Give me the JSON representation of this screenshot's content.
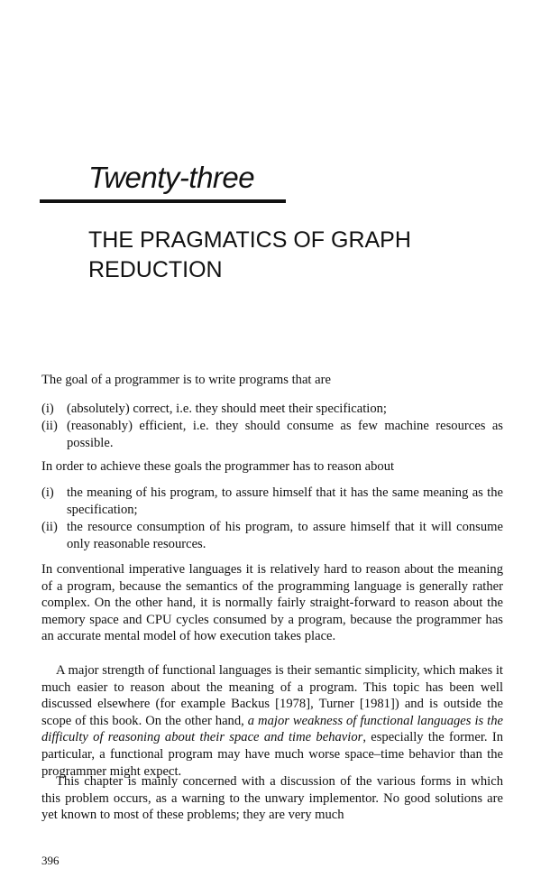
{
  "chapter": {
    "number": "Twenty-three",
    "title": "THE PRAGMATICS OF GRAPH REDUCTION"
  },
  "intro1": "The goal of a programmer is to write programs that are",
  "goals": [
    {
      "num": "(i)",
      "text": "(absolutely) correct, i.e. they should meet their specification;"
    },
    {
      "num": "(ii)",
      "text": "(reasonably) efficient, i.e. they should consume as few machine resources as possible."
    }
  ],
  "intro2": "In order to achieve these goals the programmer has to reason about",
  "reasons": [
    {
      "num": "(i)",
      "text": "the meaning of his program, to assure himself that it has the same meaning as the specification;"
    },
    {
      "num": "(ii)",
      "text": "the resource consumption of his program, to assure himself that it will consume only reasonable resources."
    }
  ],
  "para1": "In conventional imperative languages it is relatively hard to reason about the meaning of a program, because the semantics of the programming language is generally rather complex. On the other hand, it is normally fairly straight-forward to reason about the memory space and CPU cycles consumed by a program, because the programmer has an accurate mental model of how execution takes place.",
  "para2": {
    "before": "A major strength of functional languages is their semantic simplicity, which makes it much easier to reason about the meaning of a program. This topic has been well discussed elsewhere (for example Backus [1978], Turner [1981]) and is outside the scope of this book. On the other hand, ",
    "emphasis": "a major weakness of functional languages is the difficulty of reasoning about their space and time behavior",
    "after": ", especially the former. In particular, a functional program may have much worse space–time behavior than the programmer might expect."
  },
  "para3": "This chapter is mainly concerned with a discussion of the various forms in which this problem occurs, as a warning to the unwary implementor. No good solutions are yet known to most of these problems; they are very much",
  "page_number": "396"
}
